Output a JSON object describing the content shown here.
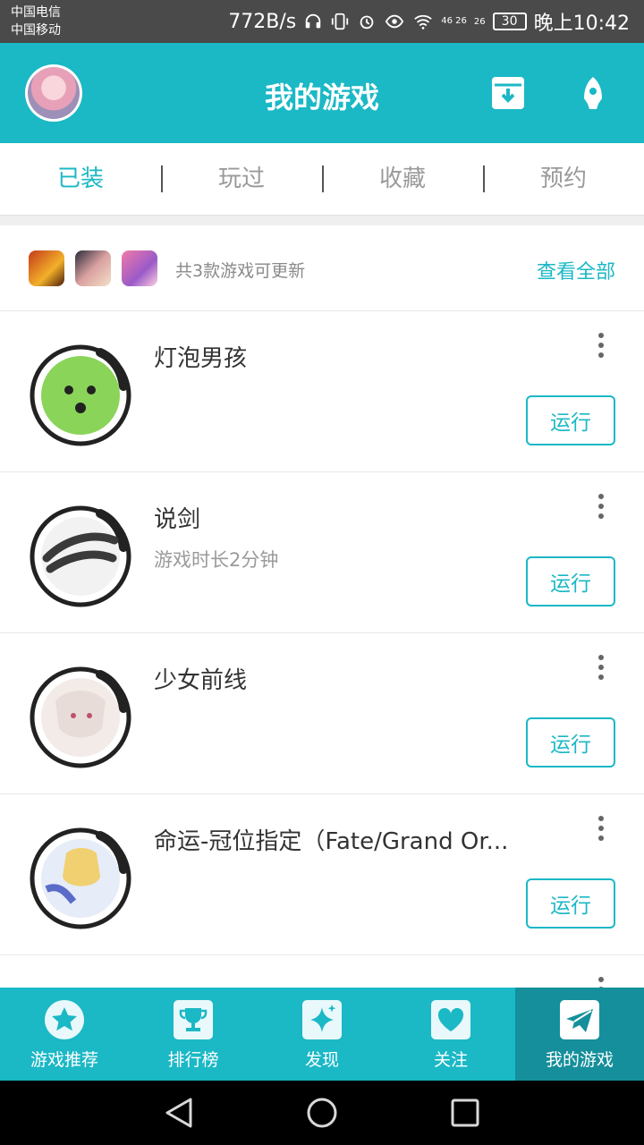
{
  "status_bar": {
    "carrier_1": "中国电信",
    "carrier_2": "中国移动",
    "network_speed": "772B/s",
    "signal_1": "46 26",
    "signal_2": "26",
    "battery": "30",
    "time": "晚上10:42"
  },
  "header": {
    "title": "我的游戏",
    "icons": [
      "avatar",
      "download-box-icon",
      "rocket-icon"
    ]
  },
  "tabs": [
    {
      "label": "已装",
      "active": true
    },
    {
      "label": "玩过",
      "active": false
    },
    {
      "label": "收藏",
      "active": false
    },
    {
      "label": "预约",
      "active": false
    }
  ],
  "updates": {
    "text": "共3款游戏可更新",
    "view_all": "查看全部"
  },
  "games": [
    {
      "name": "灯泡男孩",
      "subtitle": "",
      "run_label": "运行",
      "icon_color": "#8bd45a"
    },
    {
      "name": "说剑",
      "subtitle": "游戏时长2分钟",
      "run_label": "运行",
      "icon_color": "#3a3a3a"
    },
    {
      "name": "少女前线",
      "subtitle": "",
      "run_label": "运行",
      "icon_color": "#e8dcd8"
    },
    {
      "name": "命运-冠位指定（Fate/Grand Or...",
      "subtitle": "",
      "run_label": "运行",
      "icon_color": "#f0d070"
    }
  ],
  "bottom_nav": [
    {
      "label": "游戏推荐",
      "icon": "star-icon",
      "active": false
    },
    {
      "label": "排行榜",
      "icon": "trophy-icon",
      "active": false
    },
    {
      "label": "发现",
      "icon": "sparkle-icon",
      "active": false
    },
    {
      "label": "关注",
      "icon": "heart-icon",
      "active": false
    },
    {
      "label": "我的游戏",
      "icon": "paper-plane-icon",
      "active": true
    }
  ],
  "colors": {
    "accent": "#1bb8c6",
    "accent_dark": "#158f9b",
    "status_bar": "#4a4a4a"
  }
}
